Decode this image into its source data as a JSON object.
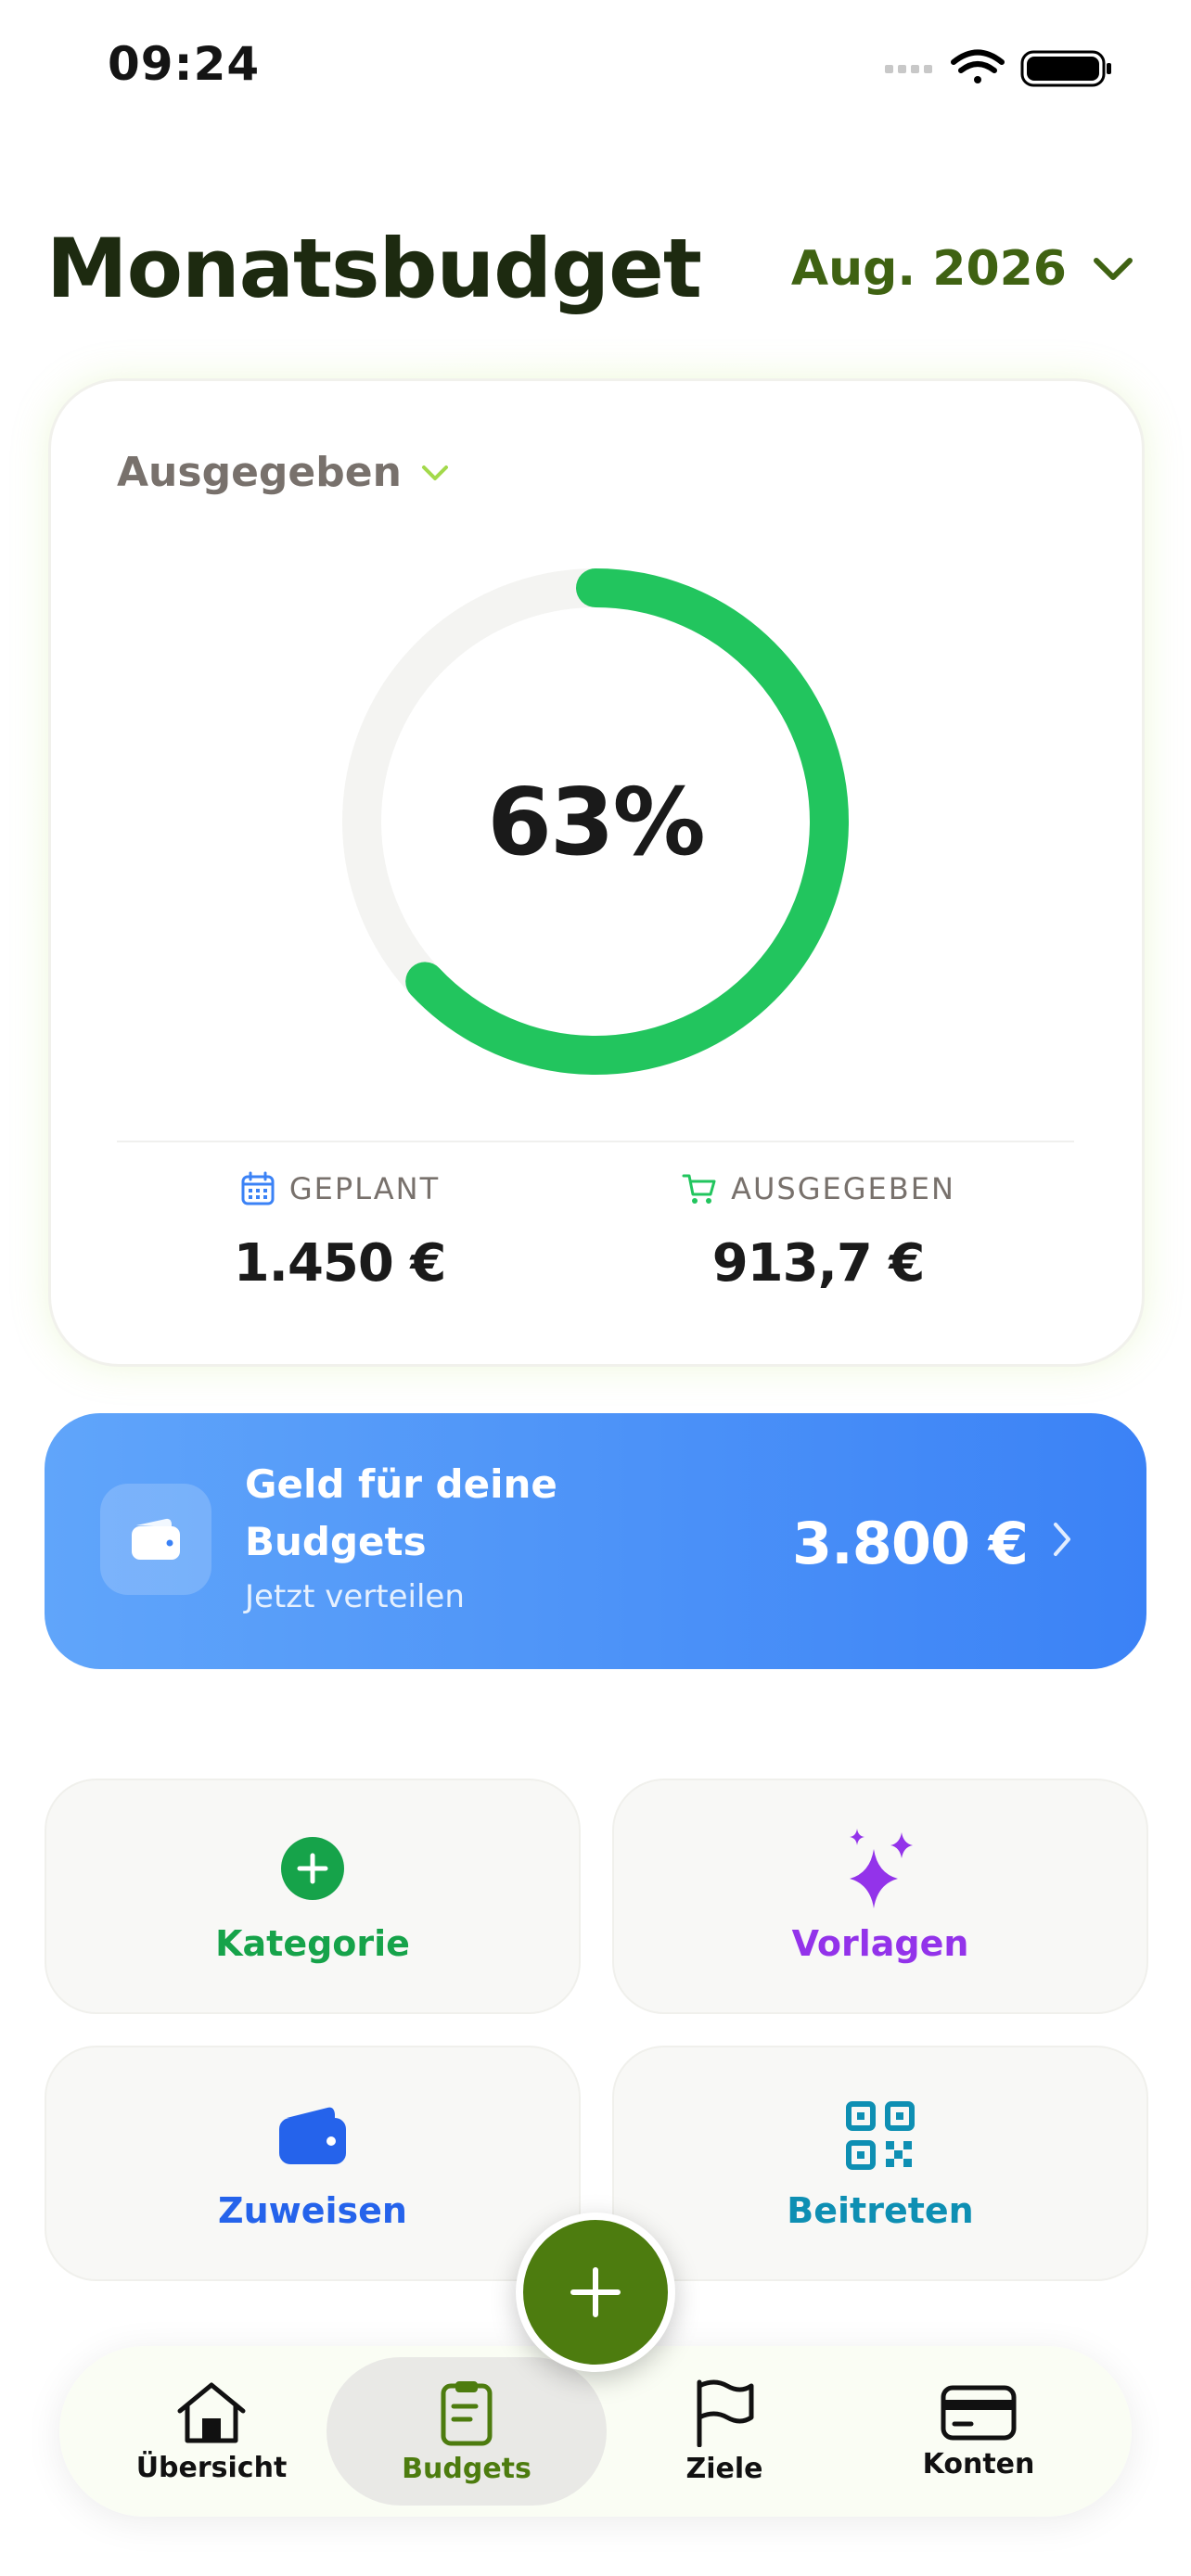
{
  "status_bar": {
    "time": "09:24"
  },
  "header": {
    "title": "Monatsbudget",
    "month": "Aug. 2026"
  },
  "summary": {
    "filter_label": "Ausgegeben",
    "percent_label": "63%",
    "progress": 0.63,
    "planned": {
      "label": "GEPLANT",
      "value": "1.450 €"
    },
    "spent": {
      "label": "AUSGEGEBEN",
      "value": "913,7 €"
    }
  },
  "banner": {
    "title": "Geld für deine Budgets",
    "subtitle": "Jetzt verteilen",
    "amount": "3.800 €"
  },
  "actions": [
    {
      "label": "Kategorie",
      "icon": "plus-circle-icon",
      "color": "#16a34a"
    },
    {
      "label": "Vorlagen",
      "icon": "sparkles-icon",
      "color": "#9333ea"
    },
    {
      "label": "Zuweisen",
      "icon": "wallet-icon",
      "color": "#2563eb"
    },
    {
      "label": "Beitreten",
      "icon": "qr-code-icon",
      "color": "#0e8fb3"
    }
  ],
  "tabs": [
    {
      "label": "Übersicht",
      "icon": "home-icon"
    },
    {
      "label": "Budgets",
      "icon": "clipboard-icon",
      "active": true
    },
    {
      "label": "Ziele",
      "icon": "flag-icon"
    },
    {
      "label": "Konten",
      "icon": "credit-card-icon"
    }
  ],
  "colors": {
    "accent": "#4d7c0f",
    "progress": "#22c55e",
    "banner": "#3b82f6"
  }
}
